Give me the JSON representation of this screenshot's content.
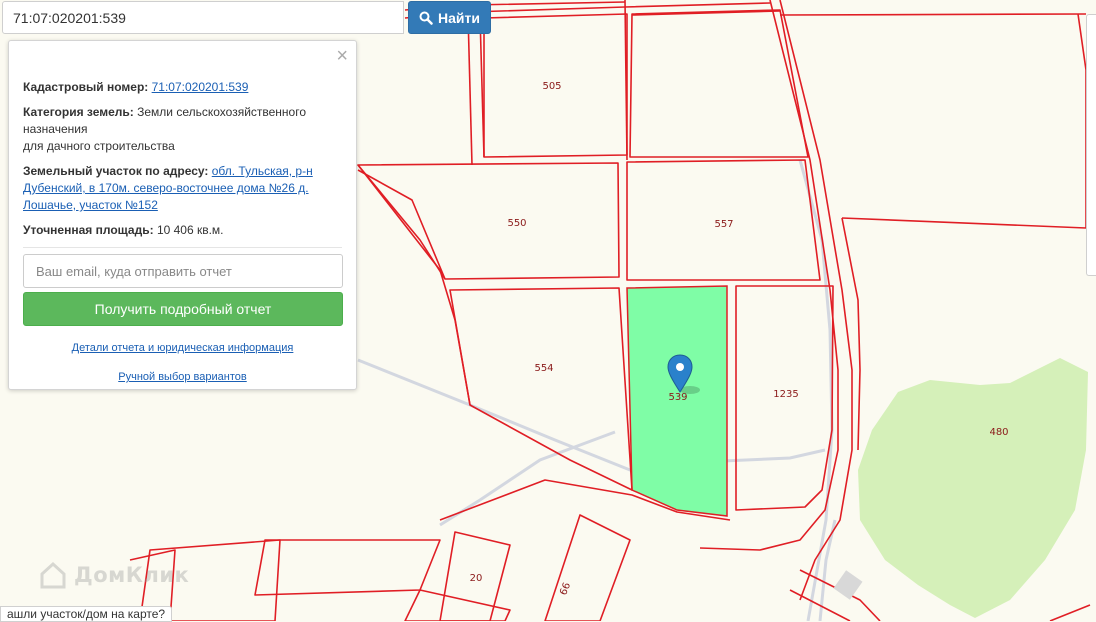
{
  "search": {
    "value": "71:07:020201:539",
    "button_label": "Найти",
    "icon": "search-icon"
  },
  "info_panel": {
    "close_label": "×",
    "cadastral_label": "Кадастровый номер:",
    "cadastral_value": "71:07:020201:539",
    "category_label": "Категория земель:",
    "category_value_1": "Земли сельскохозяйственного",
    "category_value_2": "назначения",
    "category_value_3": "для дачного строительства",
    "address_label": "Земельный участок по адресу:",
    "address_value_1": "обл. Тульская, р-н",
    "address_value_2": "Дубенский, в 170м. северо-восточнее дома №26 д.",
    "address_value_3": "Лошачье, участок №152",
    "area_label": "Уточненная площадь:",
    "area_value": "10 406 кв.м.",
    "email_placeholder": "Ваш email, куда отправить отчет",
    "report_button": "Получить подробный отчет",
    "details_link": "Детали отчета и юридическая информация",
    "manual_link": "Ручной выбор вариантов"
  },
  "map": {
    "colors": {
      "background": "#fbfaf1",
      "parcel_border": "#e01e25",
      "selected_fill": "#7ffda6",
      "forest_fill": "#d5f0b9",
      "road": "#d3d7e0",
      "marker": "#2a81cb"
    },
    "parcel_labels": {
      "p505": "505",
      "p550": "550",
      "p557": "557",
      "p554": "554",
      "p539": "539",
      "p1235": "1235",
      "p480": "480",
      "p20": "20",
      "p66": "66"
    }
  },
  "watermark": {
    "text": "ДомКлик",
    "icon": "house-logo-icon"
  },
  "bottom_hint": "ашли участок/дом на карте?"
}
